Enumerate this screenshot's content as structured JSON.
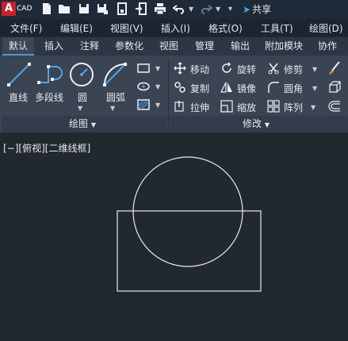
{
  "app": {
    "logo_letter": "A",
    "logo_text": "CAD",
    "share_label": "共享"
  },
  "menu": [
    "文件(F)",
    "编辑(E)",
    "视图(V)",
    "插入(I)",
    "格式(O)",
    "工具(T)",
    "绘图(D)"
  ],
  "tabs": [
    "默认",
    "插入",
    "注释",
    "参数化",
    "视图",
    "管理",
    "输出",
    "附加模块",
    "协作"
  ],
  "active_tab": "默认",
  "draw_panel": {
    "title": "绘图",
    "tools": {
      "line": "直线",
      "polyline": "多段线",
      "circle": "圆",
      "arc": "圆弧"
    }
  },
  "modify_panel": {
    "title": "修改",
    "tools": {
      "move": "移动",
      "rotate": "旋转",
      "trim": "修剪",
      "copy": "复制",
      "mirror": "镜像",
      "fillet": "圆角",
      "stretch": "拉伸",
      "scale": "缩放",
      "array": "阵列"
    }
  },
  "viewport": {
    "label": "[−][俯视][二维线框]"
  }
}
